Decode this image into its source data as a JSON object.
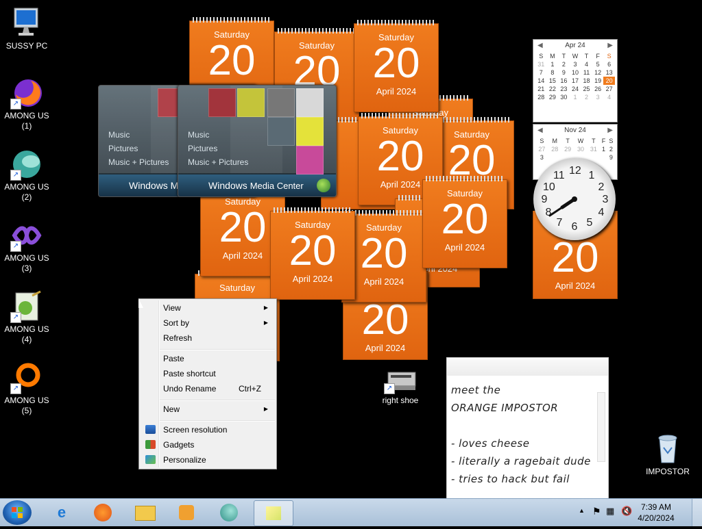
{
  "desktop_icons": [
    {
      "label": "SUSSY PC",
      "icon": "computer-icon"
    },
    {
      "label": "AMONG US\n(1)",
      "icon": "firefox-icon"
    },
    {
      "label": "AMONG US\n(2)",
      "icon": "teal-orb-icon"
    },
    {
      "label": "AMONG US\n(3)",
      "icon": "visual-studio-icon"
    },
    {
      "label": "AMONG US\n(4)",
      "icon": "notepad-frog-icon"
    },
    {
      "label": "AMONG US\n(5)",
      "icon": "orange-ring-icon"
    },
    {
      "label": "right shoe",
      "icon": "drive-icon"
    },
    {
      "label": "IMPOSTOR",
      "icon": "recycle-bin-icon"
    }
  ],
  "calendar_gadget": {
    "day": "Saturday",
    "number": "20",
    "month_year": "April 2024",
    "color": "#f07c1e"
  },
  "wmc": {
    "menu": [
      "Music",
      "Pictures",
      "Music + Pictures"
    ],
    "brand_a": "Windows",
    "brand_b": "Media Center",
    "brand_short": "Windows M"
  },
  "mini_cal_apr": {
    "title": "Apr 24",
    "weekdays": [
      "S",
      "M",
      "T",
      "W",
      "T",
      "F",
      "S"
    ],
    "rows": [
      [
        "",
        "1",
        "2",
        "3",
        "4",
        "5",
        "6"
      ],
      [
        "7",
        "8",
        "9",
        "10",
        "11",
        "12",
        "13"
      ],
      [
        "14",
        "15",
        "16",
        "17",
        "18",
        "19",
        "20"
      ],
      [
        "21",
        "22",
        "23",
        "24",
        "25",
        "26",
        "27"
      ],
      [
        "28",
        "29",
        "30",
        "1",
        "2",
        "3",
        "4"
      ]
    ],
    "lead": "31"
  },
  "mini_cal_nov": {
    "title": "Nov 24",
    "weekdays": [
      "S",
      "M",
      "T",
      "W",
      "T",
      "F",
      "S"
    ],
    "row1": [
      "27",
      "28",
      "29",
      "30",
      "31",
      "1",
      "2"
    ],
    "row2": [
      "3",
      "",
      "",
      "",
      "",
      "",
      "9"
    ]
  },
  "clock_numbers": [
    "12",
    "1",
    "2",
    "3",
    "4",
    "5",
    "6",
    "7",
    "8",
    "9",
    "10",
    "11"
  ],
  "context_menu": {
    "view": "View",
    "sort_by": "Sort by",
    "refresh": "Refresh",
    "paste": "Paste",
    "paste_shortcut": "Paste shortcut",
    "undo_rename": "Undo Rename",
    "undo_shortcut": "Ctrl+Z",
    "new": "New",
    "screen_resolution": "Screen resolution",
    "gadgets": "Gadgets",
    "personalize": "Personalize"
  },
  "sticky_note": {
    "lines": [
      "meet the",
      "ORANGE IMPOSTOR",
      "",
      "- loves cheese",
      "- literally a ragebait dude",
      "- tries to hack but fail"
    ]
  },
  "taskbar": {
    "time": "7:39 AM",
    "date": "4/20/2024",
    "pinned": [
      "internet-explorer-icon",
      "firefox-icon",
      "explorer-folder-icon",
      "media-player-icon",
      "teal-orb-icon",
      "sticky-notes-icon"
    ]
  }
}
